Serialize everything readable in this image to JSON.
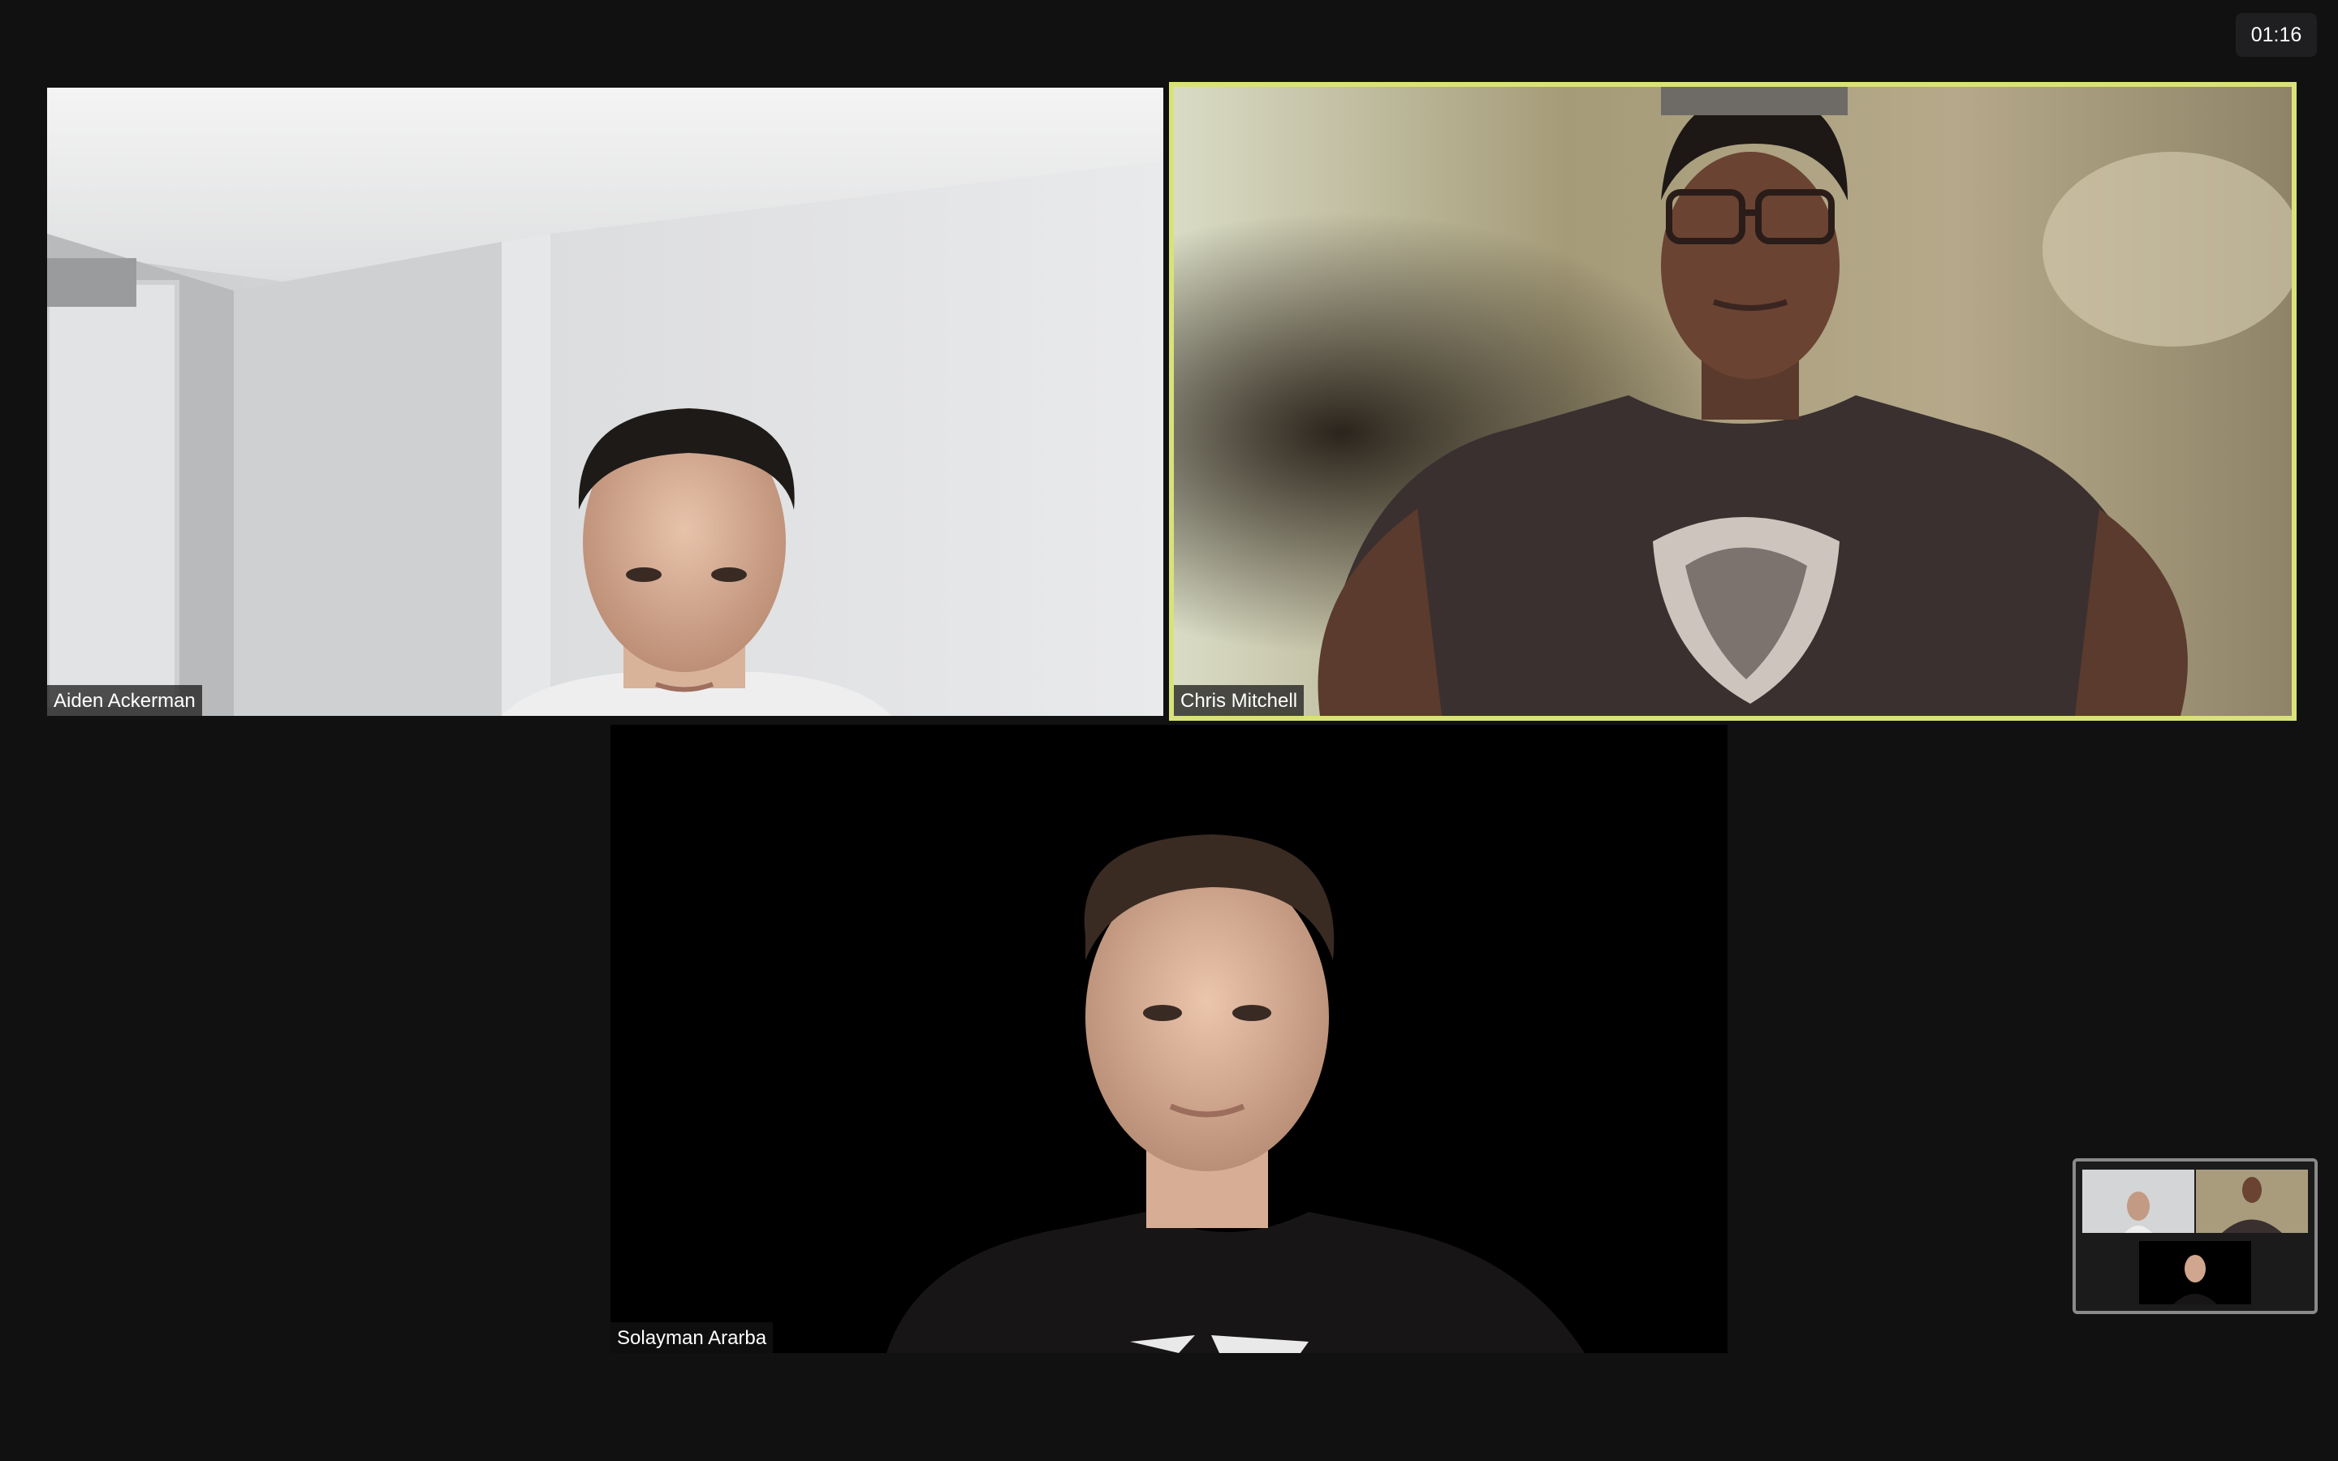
{
  "meeting": {
    "elapsed_time": "01:16"
  },
  "participants": [
    {
      "name": "Aiden Ackerman",
      "active_speaker": false
    },
    {
      "name": "Chris Mitchell",
      "active_speaker": true
    },
    {
      "name": "Solayman Ararba",
      "active_speaker": false
    }
  ],
  "colors": {
    "background": "#111112",
    "active_speaker_border": "#d9e27a",
    "thumbnail_border": "#8a8a8c"
  }
}
